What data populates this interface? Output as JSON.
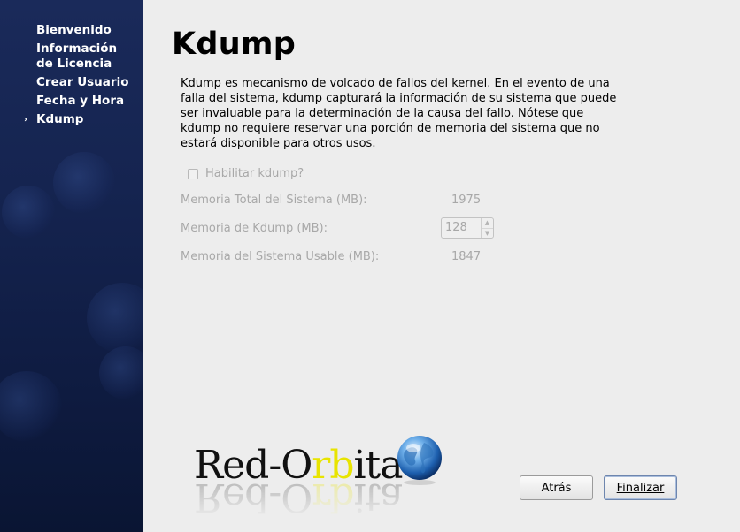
{
  "sidebar": {
    "items": [
      {
        "label": "Bienvenido",
        "current": false
      },
      {
        "label": "Información\nde Licencia",
        "current": false
      },
      {
        "label": "Crear Usuario",
        "current": false
      },
      {
        "label": "Fecha y Hora",
        "current": false
      },
      {
        "label": "Kdump",
        "current": true
      }
    ],
    "current_marker": "›"
  },
  "page": {
    "title": "Kdump",
    "description": "Kdump es mecanismo de volcado de fallos del kernel. En el evento de una falla del sistema, kdump capturará la información de su sistema que puede ser invaluable para la determinación de la causa del fallo. Nótese que kdump no requiere reservar una porción de memoria del sistema que no estará disponible para otros usos."
  },
  "form": {
    "enable_checkbox": {
      "label": "Habilitar kdump?",
      "checked": false,
      "enabled": false
    },
    "total_memory": {
      "label": "Memoria Total del Sistema (MB):",
      "value": "1975"
    },
    "kdump_memory": {
      "label": "Memoria de Kdump (MB):",
      "value": "128"
    },
    "usable_memory": {
      "label": "Memoria del Sistema Usable (MB):",
      "value": "1847"
    }
  },
  "logo": {
    "text": "Red-Orbita"
  },
  "buttons": {
    "back": "Atrás",
    "finish": "Finalizar"
  },
  "colors": {
    "sidebar_bg": "#152450",
    "main_bg": "#ededed",
    "disabled_text": "#a8a8a8",
    "logo_accent": "#e8e400"
  }
}
